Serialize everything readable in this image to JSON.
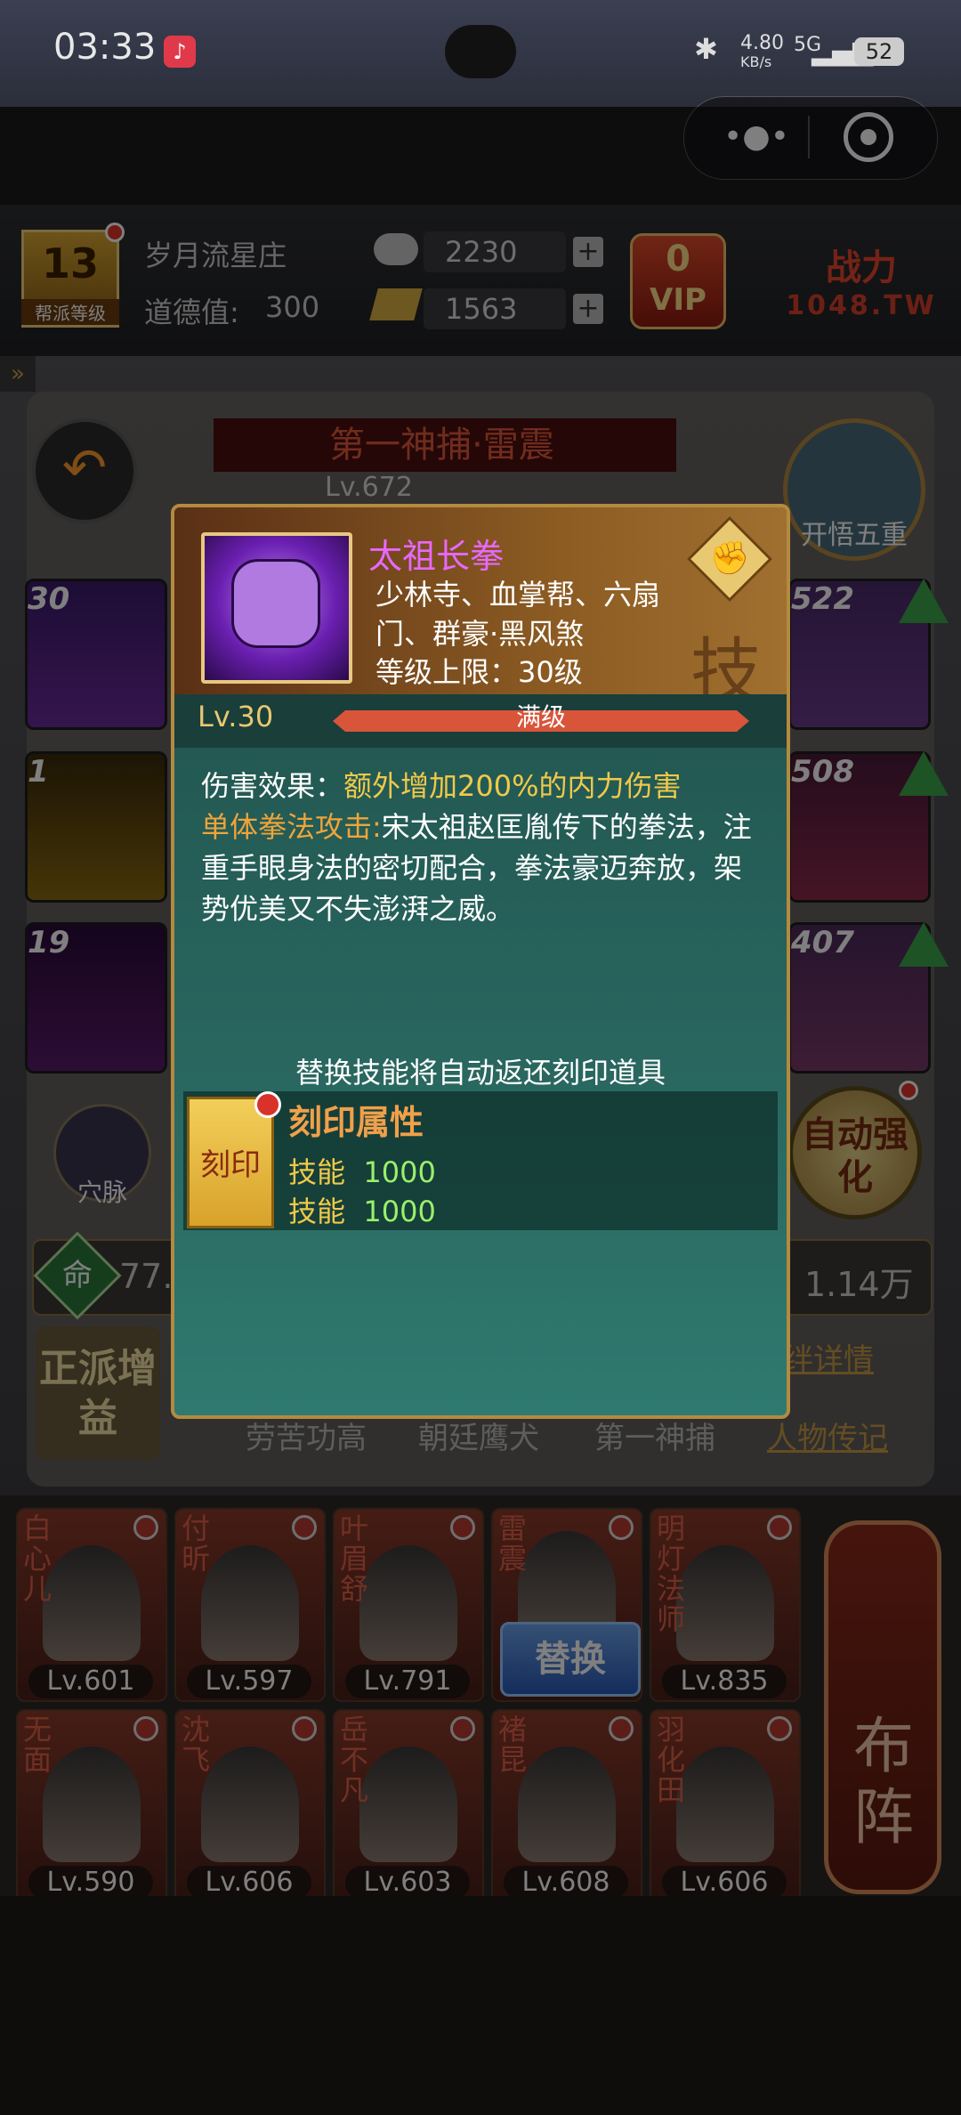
{
  "status_bar": {
    "time": "03:33",
    "speed_top": "4.80",
    "speed_unit": "KB/s",
    "network": "5G",
    "battery": "52"
  },
  "header": {
    "guild_level": "13",
    "guild_level_label": "帮派等级",
    "guild_name": "岁月流星庄",
    "morality_label": "道德值:",
    "morality_value": "300",
    "silver": "2230",
    "gold": "1563",
    "vip_level": "0",
    "vip_label": "VIP",
    "power_label": "战力",
    "power_watermark": "1048.TW"
  },
  "hero_panel": {
    "hero_title": "第一神捕·雷震",
    "hero_level": "Lv.672",
    "enlightenment_label": "开悟五重",
    "left_slots": [
      "30",
      "1",
      "19"
    ],
    "right_slots": [
      "522",
      "508",
      "407"
    ],
    "meridian_label": "穴脉",
    "auto_enhance_label": "自动强化",
    "hp_value": "77.",
    "power_value": "1.14万",
    "righteous_bonus_label": "正派增益",
    "bond_details_label": "绊详情",
    "tabs": [
      "劳苦功高",
      "朝廷鹰犬",
      "第一神捕",
      "人物传记"
    ]
  },
  "skill_modal": {
    "skill_name": "太祖长拳",
    "sects": "少林寺、血掌帮、六扇门、群豪·黑风煞",
    "level_cap": "等级上限：30级",
    "level": "Lv.30",
    "level_status": "满级",
    "damage_label": "伤害效果：",
    "damage_value": "额外增加200%的内力伤害",
    "attack_type": "单体拳法攻击:",
    "description": "宋太祖赵匡胤传下的拳法，注重手眼身法的密切配合，拳法豪迈奔放，架势优美又不失澎湃之威。",
    "replace_note": "替换技能将自动返还刻印道具",
    "stamp_label": "刻印",
    "stamp_attr_title": "刻印属性",
    "attributes": [
      {
        "name": "技能",
        "value": "1000"
      },
      {
        "name": "技能",
        "value": "1000"
      }
    ],
    "type_badge_char": "技"
  },
  "roster": {
    "row1": [
      {
        "name": "白心儿",
        "level": "Lv.601"
      },
      {
        "name": "付昕",
        "level": "Lv.597"
      },
      {
        "name": "叶眉舒",
        "level": "Lv.791"
      },
      {
        "name": "雷震",
        "level": ""
      },
      {
        "name": "明灯法师",
        "level": "Lv.835"
      }
    ],
    "row2": [
      {
        "name": "无面",
        "level": "Lv.590"
      },
      {
        "name": "沈飞",
        "level": "Lv.606"
      },
      {
        "name": "岳不凡",
        "level": "Lv.603"
      },
      {
        "name": "褚昆",
        "level": "Lv.608"
      },
      {
        "name": "羽化田",
        "level": "Lv.606"
      }
    ],
    "swap_label": "替换",
    "formation_label": "布阵"
  }
}
